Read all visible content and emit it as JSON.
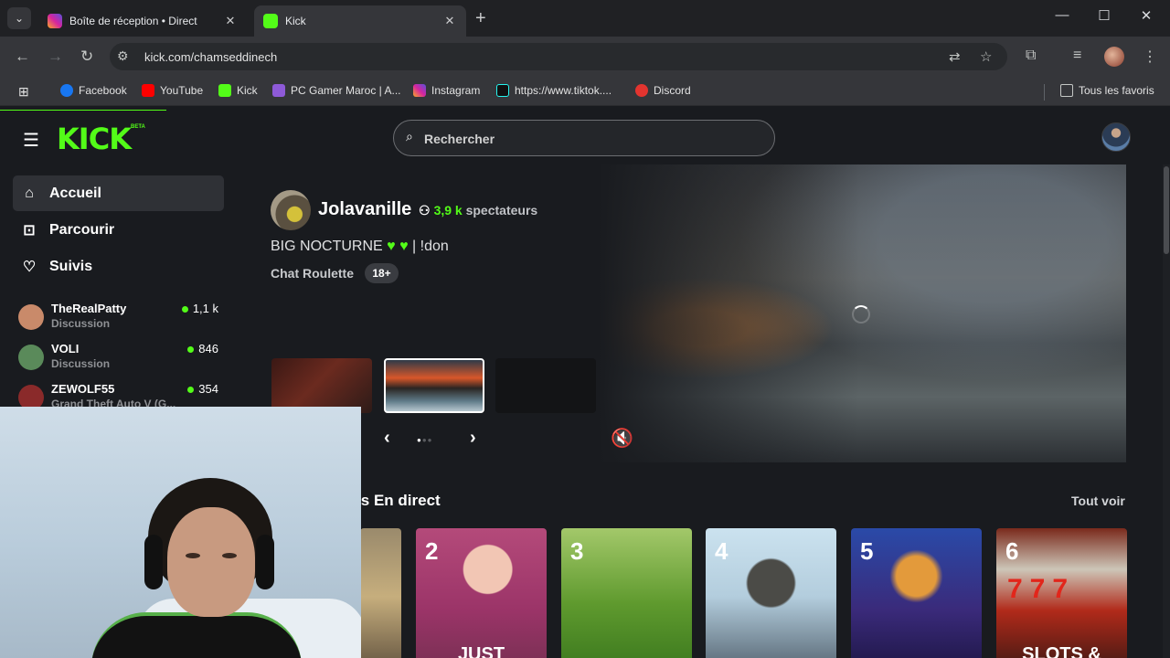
{
  "browser": {
    "tabs": [
      {
        "title": "Boîte de réception • Direct",
        "favicon_color": "#d6249f"
      },
      {
        "title": "Kick",
        "favicon_color": "#53fc18"
      }
    ],
    "url": "kick.com/chamseddinech",
    "bookmarks": [
      {
        "label": "Facebook",
        "icon_color": "#1877f2"
      },
      {
        "label": "YouTube",
        "icon_color": "#ff0000"
      },
      {
        "label": "Kick",
        "icon_color": "#53fc18"
      },
      {
        "label": "PC Gamer Maroc | A...",
        "icon_color": "#8e5ad8"
      },
      {
        "label": "Instagram",
        "icon_color": "#d6249f"
      },
      {
        "label": "https://www.tiktok....",
        "icon_color": "#111111"
      },
      {
        "label": "Discord",
        "icon_color": "#e3342f"
      }
    ],
    "all_bookmarks": "Tous les favoris"
  },
  "header": {
    "logo": "KICK",
    "beta": "BETA",
    "search_placeholder": "Rechercher"
  },
  "sidebar": {
    "nav": [
      {
        "label": "Accueil",
        "icon": "home-icon",
        "active": true
      },
      {
        "label": "Parcourir",
        "icon": "browse-icon",
        "active": false
      },
      {
        "label": "Suivis",
        "icon": "heart-icon",
        "active": false
      }
    ],
    "channels": [
      {
        "name": "TheRealPatty",
        "category": "Discussion",
        "viewers": "1,1 k",
        "avatar_color": "#c98a6a"
      },
      {
        "name": "VOLI",
        "category": "Discussion",
        "viewers": "846",
        "avatar_color": "#5a8a5a"
      },
      {
        "name": "ZEWOLF55",
        "category": "Grand Theft Auto V (G...",
        "viewers": "354",
        "avatar_color": "#8a2a2a"
      }
    ]
  },
  "featured": {
    "streamer": "Jolavanille",
    "viewer_count": "3,9 k",
    "viewer_label": "spectateurs",
    "title_start": "BIG NOCTURNE",
    "title_end": "| !don",
    "category": "Chat Roulette",
    "age": "18+"
  },
  "categories_section": {
    "title": "ries En direct",
    "see_all": "Tout voir",
    "cards": [
      {
        "rank": "",
        "text": ""
      },
      {
        "rank": "2",
        "text": "JUST"
      },
      {
        "rank": "3",
        "text": ""
      },
      {
        "rank": "4",
        "text": ""
      },
      {
        "rank": "5",
        "text": ""
      },
      {
        "rank": "6",
        "text": "SLOTS &"
      }
    ]
  }
}
